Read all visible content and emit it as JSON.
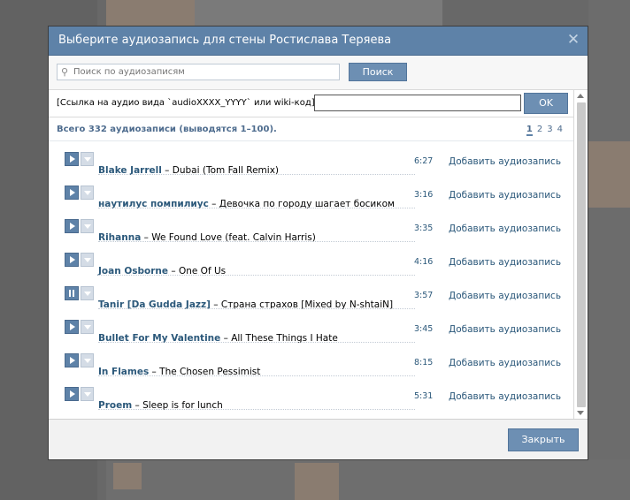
{
  "dialog": {
    "title": "Выберите аудиозапись для стены Ростислава Теряева",
    "close_icon": "close-icon"
  },
  "search": {
    "placeholder": "Поиск по аудиозаписям",
    "button_label": "Поиск"
  },
  "link": {
    "label": "[Ссылка на аудио вида `audioXXXX_YYYY` или wiki-код]:",
    "value": "",
    "ok_label": "OK"
  },
  "summary": {
    "text": "Всего 332 аудиозаписи (выводятся 1–100).",
    "pages": [
      "1",
      "2",
      "3",
      "4"
    ],
    "current_page": "1"
  },
  "tracks": [
    {
      "artist": "Blake Jarrell",
      "title": "Dubai (Tom Fall Remix)",
      "duration": "6:27",
      "state": "play"
    },
    {
      "artist": "наутилус помпилиус",
      "title": "Девочка по городу шагает босиком",
      "duration": "3:16",
      "state": "play"
    },
    {
      "artist": "Rihanna",
      "title": "We Found Love (feat. Calvin Harris)",
      "duration": "3:35",
      "state": "play"
    },
    {
      "artist": "Joan Osborne",
      "title": "One Of Us",
      "duration": "4:16",
      "state": "play"
    },
    {
      "artist": "Tanir [Da Gudda Jazz]",
      "title": "Страна страхов [Mixed by N-shtaiN]",
      "duration": "3:57",
      "state": "pause"
    },
    {
      "artist": "Bullet For My Valentine",
      "title": "All These Things I Hate",
      "duration": "3:45",
      "state": "play"
    },
    {
      "artist": "In Flames",
      "title": "The Chosen Pessimist",
      "duration": "8:15",
      "state": "play"
    },
    {
      "artist": "Proem",
      "title": "Sleep is for lunch",
      "duration": "5:31",
      "state": "play"
    }
  ],
  "add_label": "Добавить аудиозапись",
  "dash": " – ",
  "footer": {
    "close_label": "Закрыть"
  },
  "colors": {
    "header": "#5e82a8",
    "button": "#6d8fb3",
    "link": "#2b587a"
  }
}
